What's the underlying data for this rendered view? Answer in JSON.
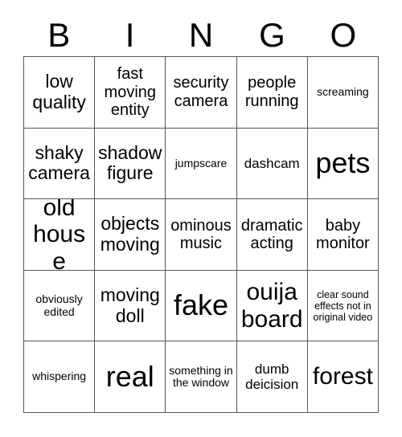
{
  "card": {
    "title": "BINGO",
    "header_letters": [
      "B",
      "I",
      "N",
      "G",
      "O"
    ],
    "grid_size": "5x5",
    "border_color": "#555555",
    "text_color": "#000000",
    "background_color": "#ffffff",
    "rows": [
      [
        {
          "text": "low quality",
          "size": "l"
        },
        {
          "text": "fast moving entity",
          "size": "m"
        },
        {
          "text": "security camera",
          "size": "m"
        },
        {
          "text": "people running",
          "size": "m"
        },
        {
          "text": "screaming",
          "size": "xs"
        }
      ],
      [
        {
          "text": "shaky camera",
          "size": "l"
        },
        {
          "text": "shadow figure",
          "size": "l"
        },
        {
          "text": "jumpscare",
          "size": "xs"
        },
        {
          "text": "dashcam",
          "size": "s"
        },
        {
          "text": "pets",
          "size": "xxl"
        }
      ],
      [
        {
          "text": "old house",
          "size": "xl"
        },
        {
          "text": "objects moving",
          "size": "l"
        },
        {
          "text": "ominous music",
          "size": "m"
        },
        {
          "text": "dramatic acting",
          "size": "m"
        },
        {
          "text": "baby monitor",
          "size": "m"
        }
      ],
      [
        {
          "text": "obviously edited",
          "size": "xs"
        },
        {
          "text": "moving doll",
          "size": "l"
        },
        {
          "text": "fake",
          "size": "xxl"
        },
        {
          "text": "ouija board",
          "size": "xl"
        },
        {
          "text": "clear sound effects not in original video",
          "size": "xxs"
        }
      ],
      [
        {
          "text": "whispering",
          "size": "xs"
        },
        {
          "text": "real",
          "size": "xxl"
        },
        {
          "text": "something in the window",
          "size": "xs"
        },
        {
          "text": "dumb deicision",
          "size": "s"
        },
        {
          "text": "forest",
          "size": "xl"
        }
      ]
    ]
  }
}
